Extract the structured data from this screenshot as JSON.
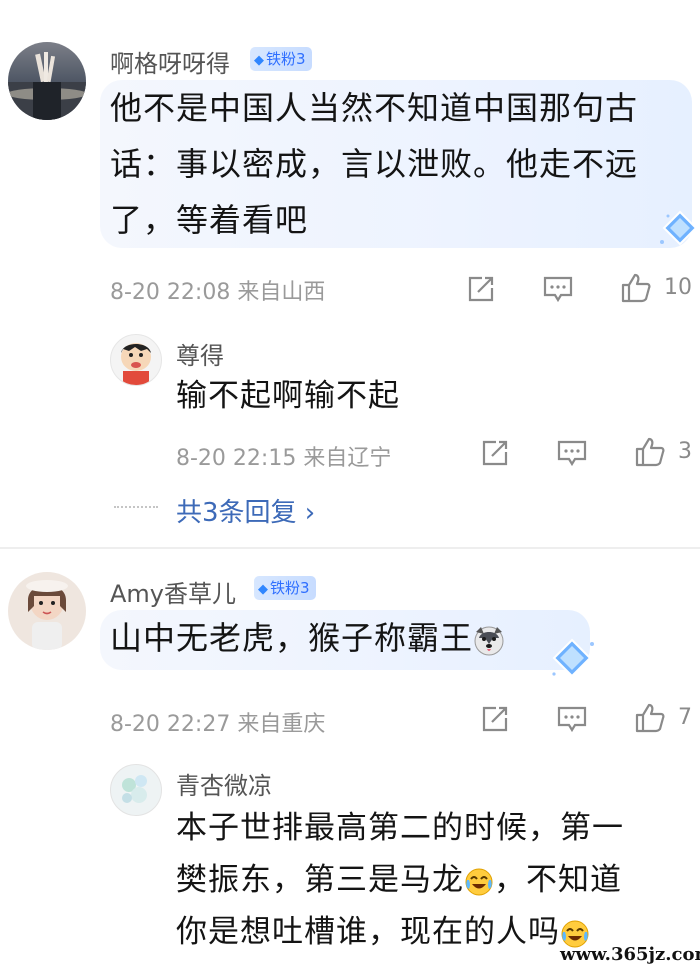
{
  "comments": [
    {
      "username": "啊格呀呀得",
      "badge": "铁粉3",
      "lines": [
        "他不是中国人当然不知道中国那句古",
        "话：事以密成，言以泄败。他走不远",
        "了，等着看吧"
      ],
      "meta": "8-20 22:08 来自山西",
      "likes": "10"
    },
    {
      "username": "Amy香草儿",
      "badge": "铁粉3",
      "text": "山中无老虎，猴子称霸王",
      "meta": "8-20 22:27 来自重庆",
      "likes": "7"
    }
  ],
  "replies": [
    {
      "username": "尊得",
      "text": "输不起啊输不起",
      "meta": "8-20 22:15 来自辽宁",
      "likes": "3",
      "more": "共3条回复 ›"
    },
    {
      "username": "青杏微凉",
      "line1": "本子世排最高第二的时候，第一",
      "line2a": "樊振东，第三是马龙",
      "line2b": "，不知道",
      "line3": "你是想吐槽谁，现在的人吗"
    }
  ],
  "watermark": {
    "site": "www.365jz.com"
  },
  "icons": {
    "share": "share-icon",
    "comment": "comment-icon",
    "like": "like-icon",
    "badge": "diamond-icon",
    "emoji_husky": "husky-emoji-icon",
    "emoji_cry": "laugh-cry-emoji-icon"
  },
  "colors": {
    "badge_text": "#2f6fff",
    "badge_bg": "#d7e7ff",
    "link": "#3d6ab8",
    "meta": "#9a9a9a",
    "bubble": "#edf3ff"
  }
}
